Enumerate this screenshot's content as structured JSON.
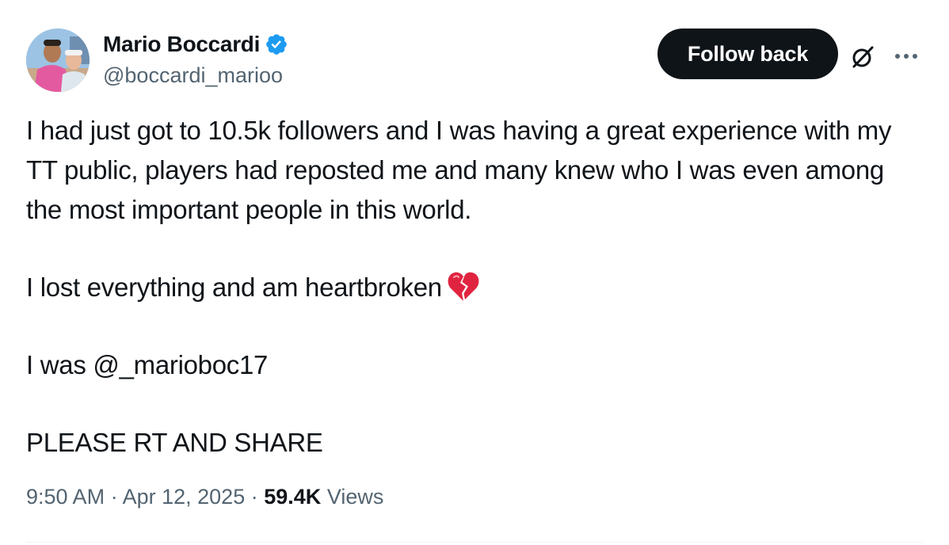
{
  "author": {
    "display_name": "Mario Boccardi",
    "handle": "@boccardi_marioo",
    "verified": true,
    "verified_color": "#1d9bf0",
    "avatar_icon": "profile-photo"
  },
  "actions": {
    "follow_label": "Follow back",
    "grok_icon": "grok-icon",
    "more_icon": "more-icon"
  },
  "tweet": {
    "paragraphs": [
      "I had just got to 10.5k followers and I was having a great experience with my TT public, players had reposted me and many knew who I was even among the most important people in this world.",
      "I lost everything and am heartbroken",
      "I was @_marioboc17",
      "PLEASE RT AND SHARE"
    ],
    "emoji_icon": "broken-heart-icon"
  },
  "meta": {
    "time": "9:50 AM",
    "separator": "·",
    "date": "Apr 12, 2025",
    "views_count": "59.4K",
    "views_label": "Views"
  },
  "colors": {
    "text": "#0f1419",
    "secondary": "#536471",
    "button_bg": "#0f1419",
    "button_text": "#ffffff"
  }
}
